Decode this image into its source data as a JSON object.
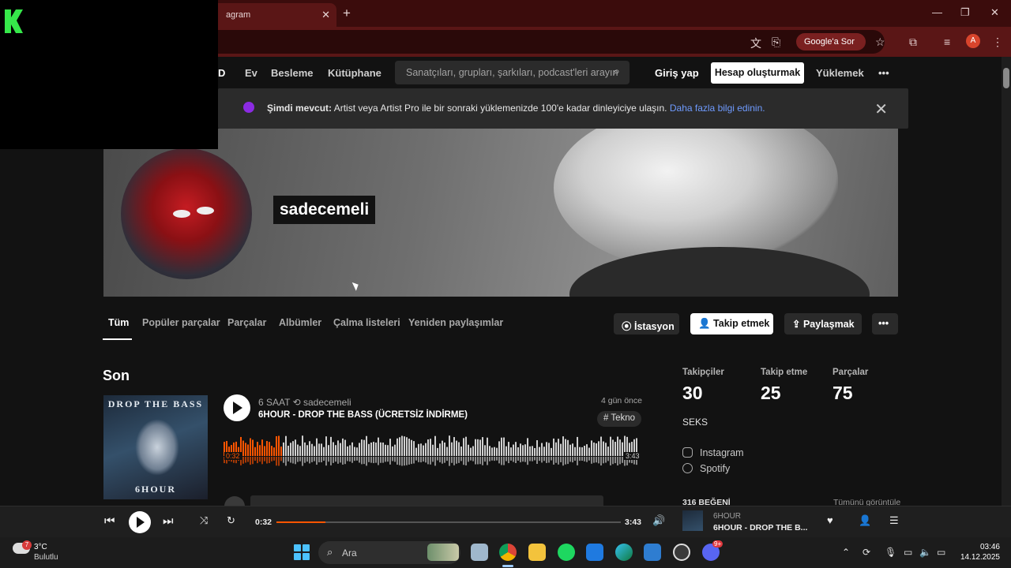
{
  "browser": {
    "tab_title": "agram",
    "address": "i",
    "google_btn": "Google'a Sor",
    "profile_initial": "A"
  },
  "nav": {
    "logo_fragment": "D",
    "home": "Ev",
    "feed": "Besleme",
    "library": "Kütüphane",
    "search_placeholder": "Sanatçıları, grupları, şarkıları, podcast'leri arayın",
    "login": "Giriş yap",
    "signup": "Hesap oluşturmak",
    "upload": "Yüklemek",
    "more": "•••"
  },
  "banner": {
    "bold": "Şimdi mevcut:",
    "text": " Artist veya Artist Pro ile bir sonraki yüklemenizde 100'e kadar dinleyiciye ulaşın. ",
    "link": "Daha fazla bilgi edinin."
  },
  "profile": {
    "name": "sadecemeli",
    "tabs": [
      "Tüm",
      "Popüler parçalar",
      "Parçalar",
      "Albümler",
      "Çalma listeleri",
      "Yeniden paylaşımlar"
    ],
    "station": "İstasyon",
    "follow": "Takip etmek",
    "share": "Paylaşmak",
    "more": "•••"
  },
  "recent": {
    "heading": "Son",
    "track": {
      "artist": "6 SAAT",
      "reposter": "sadecemeli",
      "title": "6HOUR - DROP THE BASS (ÜCRETSİZ İNDİRME)",
      "age": "4 gün önce",
      "tag": "# Tekno",
      "time_start": "0:32",
      "time_end": "3:43",
      "cover_top": "DROP THE BASS",
      "cover_bottom": "6HOUR",
      "played_fraction": 0.143
    }
  },
  "stats": {
    "followers_label": "Takipçiler",
    "followers": "30",
    "following_label": "Takip etme",
    "following": "25",
    "tracks_label": "Parçalar",
    "tracks": "75",
    "bio": "SEKS",
    "links": [
      "Instagram",
      "Spotify"
    ],
    "likes": "316 BEĞENİ",
    "view_all": "Tümünü görüntüle"
  },
  "player": {
    "current": "0:32",
    "duration": "3:43",
    "progress_fraction": 0.143,
    "artist": "6HOUR",
    "title": "6HOUR - DROP THE B..."
  },
  "taskbar": {
    "weather_badge": "7",
    "temp": "3°C",
    "condition": "Bulutlu",
    "search": "Ara",
    "time": "03:46",
    "date": "14.12.2025",
    "notif_badge": "9+"
  },
  "colors": {
    "accent": "#ff5500",
    "chrome_dark": "#3b0c0c",
    "chrome": "#5a1616",
    "link": "#6f9bff",
    "logo_green": "#36e84a"
  }
}
